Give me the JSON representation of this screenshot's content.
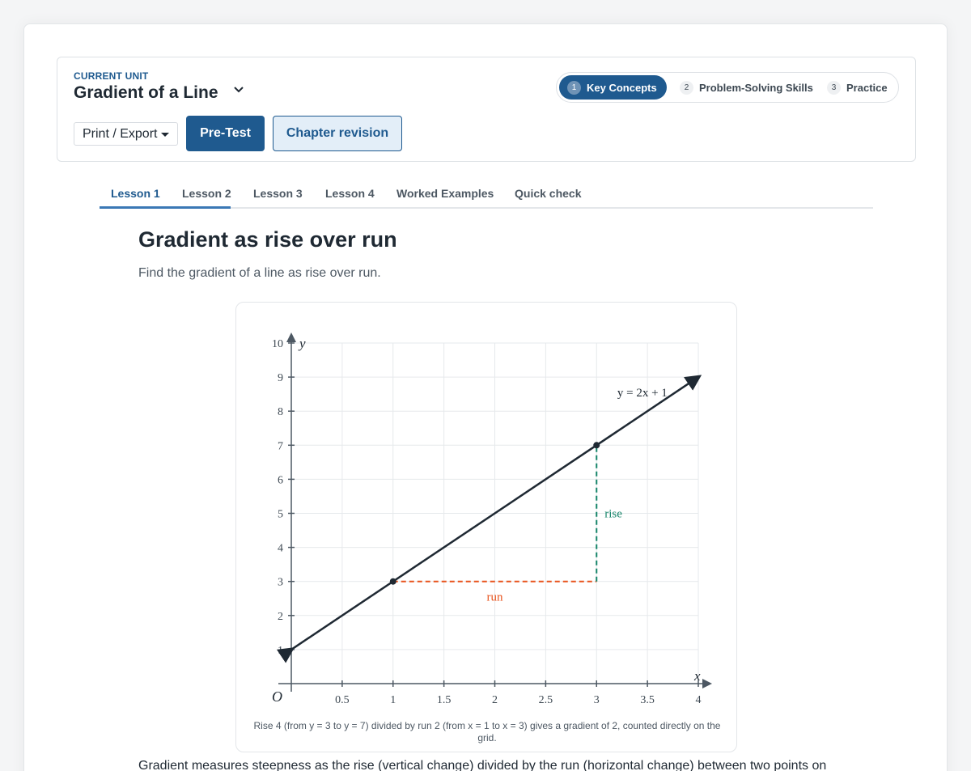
{
  "header": {
    "current_unit_label": "CURRENT UNIT",
    "unit_title": "Gradient of a Line",
    "print_export_label": "Print / Export",
    "pretest_label": "Pre-Test",
    "chapter_revision_label": "Chapter revision"
  },
  "stepper": {
    "steps": [
      {
        "num": "1",
        "label": "Key Concepts",
        "active": true
      },
      {
        "num": "2",
        "label": "Problem-Solving Skills",
        "active": false
      },
      {
        "num": "3",
        "label": "Practice",
        "active": false
      }
    ]
  },
  "tabs": [
    {
      "label": "Lesson 1",
      "active": true
    },
    {
      "label": "Lesson 2"
    },
    {
      "label": "Lesson 3"
    },
    {
      "label": "Lesson 4"
    },
    {
      "label": "Worked Examples"
    },
    {
      "label": "Quick check"
    }
  ],
  "lesson": {
    "title": "Gradient as rise over run",
    "subtitle": "Find the gradient of a line as rise over run.",
    "caption": "Rise 4 (from y = 3 to y = 7) divided by run 2 (from x = 1 to x = 3) gives a gradient of 2, counted directly on the grid.",
    "body": "Gradient measures steepness as the rise (vertical change) divided by the run (horizontal change) between two points on"
  },
  "chart_data": {
    "type": "line",
    "x_axis_label": "x",
    "y_axis_label": "y",
    "origin_label": "O",
    "xlim": [
      0,
      4
    ],
    "ylim": [
      0,
      10
    ],
    "x_ticks": [
      "0.5",
      "1",
      "1.5",
      "2",
      "2.5",
      "3",
      "3.5",
      "4"
    ],
    "x_tick_values": [
      0.5,
      1,
      1.5,
      2,
      2.5,
      3,
      3.5,
      4
    ],
    "y_ticks": [
      "1",
      "2",
      "3",
      "4",
      "5",
      "6",
      "7",
      "8",
      "9",
      "10"
    ],
    "y_tick_values": [
      1,
      2,
      3,
      4,
      5,
      6,
      7,
      8,
      9,
      10
    ],
    "grid": true,
    "line": {
      "label": "y = 2x + 1",
      "x": [
        0,
        4
      ],
      "y": [
        1,
        9
      ],
      "color": "#1f2933"
    },
    "points": [
      {
        "x": 1,
        "y": 3
      },
      {
        "x": 3,
        "y": 7
      }
    ],
    "run": {
      "label": "run",
      "from": [
        1,
        3
      ],
      "to": [
        3,
        3
      ],
      "color": "#e8531c"
    },
    "rise": {
      "label": "rise",
      "from": [
        3,
        3
      ],
      "to": [
        3,
        7
      ],
      "color": "#17856a"
    }
  }
}
